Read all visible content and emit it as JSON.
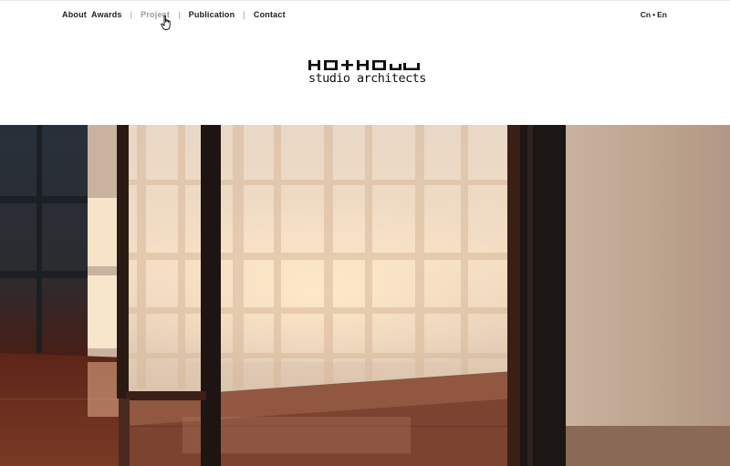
{
  "nav": {
    "items": [
      {
        "label": "About  Awards",
        "active": false
      },
      {
        "label": "Project",
        "active": true
      },
      {
        "label": "Publication",
        "active": false
      },
      {
        "label": "Contact",
        "active": false
      }
    ],
    "separator": "|"
  },
  "lang": {
    "cn": "Cn",
    "dot": "•",
    "en": "En"
  },
  "logo": {
    "wordmark": "HO+HOu",
    "subtitle": "studio architects"
  },
  "hero": {
    "icon": "architecture-photo"
  },
  "cursor": {
    "icon": "hand-pointer-icon"
  },
  "colors": {
    "text": "#1e1e1e",
    "active_nav": "#9a9a9a",
    "background": "#ffffff"
  }
}
